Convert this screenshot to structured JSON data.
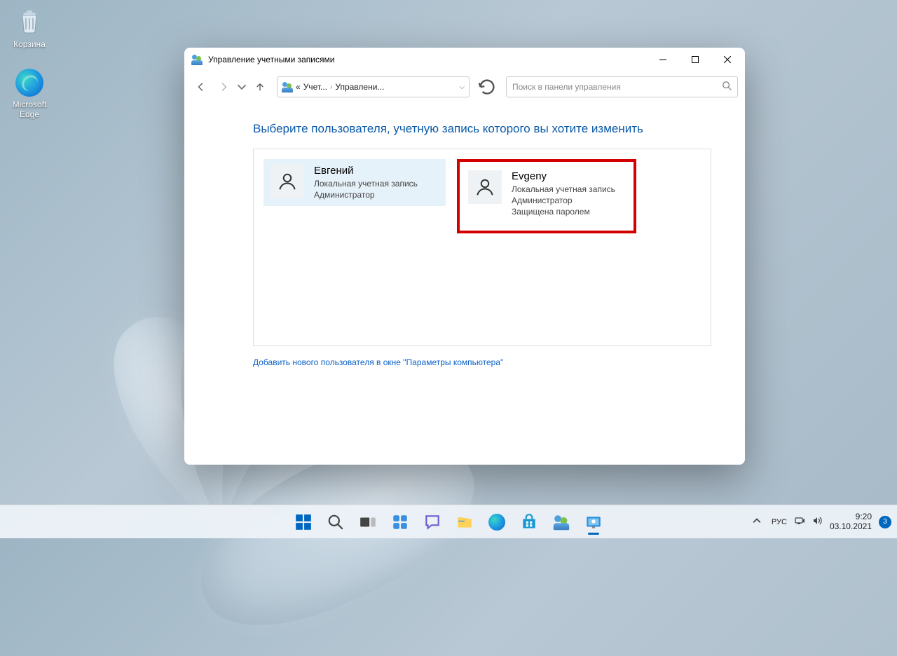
{
  "desktop": {
    "recycle_bin_label": "Корзина",
    "edge_label": "Microsoft Edge"
  },
  "window": {
    "title": "Управление учетными записями",
    "breadcrumb": {
      "prefix": "«",
      "part1": "Учет...",
      "part2": "Управлени..."
    },
    "search_placeholder": "Поиск в панели управления"
  },
  "content": {
    "heading": "Выберите пользователя, учетную запись которого вы хотите изменить",
    "users": [
      {
        "name": "Евгений",
        "line1": "Локальная учетная запись",
        "line2": "Администратор",
        "line3": ""
      },
      {
        "name": "Evgeny",
        "line1": "Локальная учетная запись",
        "line2": "Администратор",
        "line3": "Защищена паролем"
      }
    ],
    "add_user_link": "Добавить нового пользователя в окне \"Параметры компьютера\""
  },
  "tray": {
    "lang": "РУС",
    "time": "9:20",
    "date": "03.10.2021",
    "notif_count": "3"
  }
}
